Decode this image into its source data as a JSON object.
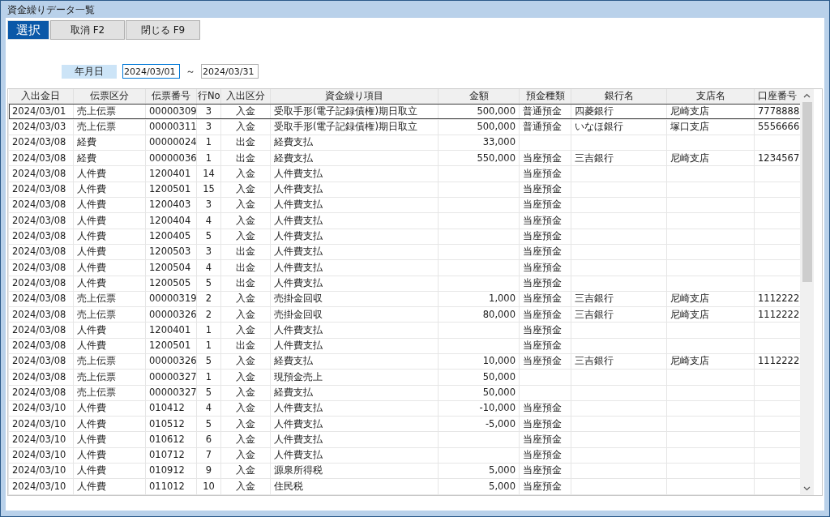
{
  "window": {
    "title": "資金繰りデータ一覧"
  },
  "toolbar": [
    {
      "label": "選択",
      "kind": "primary"
    },
    {
      "label": "取消 F2",
      "kind": "normal"
    },
    {
      "label": "閉じる F9",
      "kind": "normal"
    }
  ],
  "date_range": {
    "label": "年月日",
    "from": "2024/03/01",
    "separator": "～",
    "to": "2024/03/31"
  },
  "table": {
    "columns": [
      "入出金日",
      "伝票区分",
      "伝票番号",
      "行No",
      "入出区分",
      "資金繰り項目",
      "金額",
      "預金種類",
      "銀行名",
      "支店名",
      "口座番号"
    ],
    "rows": [
      {
        "selected": true,
        "cells": [
          "2024/03/01",
          "売上伝票",
          "00000309",
          "3",
          "入金",
          "受取手形(電子記録債権)期日取立",
          "500,000",
          "普通預金",
          "四菱銀行",
          "尼崎支店",
          "7778888"
        ]
      },
      {
        "selected": false,
        "cells": [
          "2024/03/03",
          "売上伝票",
          "00000311",
          "3",
          "入金",
          "受取手形(電子記録債権)期日取立",
          "500,000",
          "普通預金",
          "いなほ銀行",
          "塚口支店",
          "5556666"
        ]
      },
      {
        "selected": false,
        "cells": [
          "2024/03/08",
          "経費",
          "00000024",
          "1",
          "出金",
          "経費支払",
          "33,000",
          "",
          "",
          "",
          ""
        ]
      },
      {
        "selected": false,
        "cells": [
          "2024/03/08",
          "経費",
          "00000036",
          "1",
          "出金",
          "経費支払",
          "550,000",
          "当座預金",
          "三吉銀行",
          "尼崎支店",
          "1234567"
        ]
      },
      {
        "selected": false,
        "cells": [
          "2024/03/08",
          "人件費",
          "1200401",
          "14",
          "入金",
          "人件費支払",
          "",
          "当座預金",
          "",
          "",
          ""
        ]
      },
      {
        "selected": false,
        "cells": [
          "2024/03/08",
          "人件費",
          "1200501",
          "15",
          "入金",
          "人件費支払",
          "",
          "当座預金",
          "",
          "",
          ""
        ]
      },
      {
        "selected": false,
        "cells": [
          "2024/03/08",
          "人件費",
          "1200403",
          "3",
          "入金",
          "人件費支払",
          "",
          "当座預金",
          "",
          "",
          ""
        ]
      },
      {
        "selected": false,
        "cells": [
          "2024/03/08",
          "人件費",
          "1200404",
          "4",
          "入金",
          "人件費支払",
          "",
          "当座預金",
          "",
          "",
          ""
        ]
      },
      {
        "selected": false,
        "cells": [
          "2024/03/08",
          "人件費",
          "1200405",
          "5",
          "入金",
          "人件費支払",
          "",
          "当座預金",
          "",
          "",
          ""
        ]
      },
      {
        "selected": false,
        "cells": [
          "2024/03/08",
          "人件費",
          "1200503",
          "3",
          "出金",
          "人件費支払",
          "",
          "当座預金",
          "",
          "",
          ""
        ]
      },
      {
        "selected": false,
        "cells": [
          "2024/03/08",
          "人件費",
          "1200504",
          "4",
          "出金",
          "人件費支払",
          "",
          "当座預金",
          "",
          "",
          ""
        ]
      },
      {
        "selected": false,
        "cells": [
          "2024/03/08",
          "人件費",
          "1200505",
          "5",
          "出金",
          "人件費支払",
          "",
          "当座預金",
          "",
          "",
          ""
        ]
      },
      {
        "selected": false,
        "cells": [
          "2024/03/08",
          "売上伝票",
          "00000319",
          "2",
          "入金",
          "売掛金回収",
          "1,000",
          "当座預金",
          "三吉銀行",
          "尼崎支店",
          "1112222"
        ]
      },
      {
        "selected": false,
        "cells": [
          "2024/03/08",
          "売上伝票",
          "00000326",
          "2",
          "入金",
          "売掛金回収",
          "80,000",
          "当座預金",
          "三吉銀行",
          "尼崎支店",
          "1112222"
        ]
      },
      {
        "selected": false,
        "cells": [
          "2024/03/08",
          "人件費",
          "1200401",
          "1",
          "入金",
          "人件費支払",
          "",
          "当座預金",
          "",
          "",
          ""
        ]
      },
      {
        "selected": false,
        "cells": [
          "2024/03/08",
          "人件費",
          "1200501",
          "1",
          "出金",
          "人件費支払",
          "",
          "当座預金",
          "",
          "",
          ""
        ]
      },
      {
        "selected": false,
        "cells": [
          "2024/03/08",
          "売上伝票",
          "00000326",
          "5",
          "入金",
          "経費支払",
          "10,000",
          "当座預金",
          "三吉銀行",
          "尼崎支店",
          "1112222"
        ]
      },
      {
        "selected": false,
        "cells": [
          "2024/03/08",
          "売上伝票",
          "00000327",
          "1",
          "入金",
          "現預金売上",
          "50,000",
          "",
          "",
          "",
          ""
        ]
      },
      {
        "selected": false,
        "cells": [
          "2024/03/08",
          "売上伝票",
          "00000327",
          "5",
          "入金",
          "経費支払",
          "50,000",
          "",
          "",
          "",
          ""
        ]
      },
      {
        "selected": false,
        "cells": [
          "2024/03/10",
          "人件費",
          "010412",
          "4",
          "入金",
          "人件費支払",
          "-10,000",
          "当座預金",
          "",
          "",
          ""
        ]
      },
      {
        "selected": false,
        "cells": [
          "2024/03/10",
          "人件費",
          "010512",
          "5",
          "入金",
          "人件費支払",
          "-5,000",
          "当座預金",
          "",
          "",
          ""
        ]
      },
      {
        "selected": false,
        "cells": [
          "2024/03/10",
          "人件費",
          "010612",
          "6",
          "入金",
          "人件費支払",
          "",
          "当座預金",
          "",
          "",
          ""
        ]
      },
      {
        "selected": false,
        "cells": [
          "2024/03/10",
          "人件費",
          "010712",
          "7",
          "入金",
          "人件費支払",
          "",
          "当座預金",
          "",
          "",
          ""
        ]
      },
      {
        "selected": false,
        "cells": [
          "2024/03/10",
          "人件費",
          "010912",
          "9",
          "入金",
          "源泉所得税",
          "5,000",
          "当座預金",
          "",
          "",
          ""
        ]
      },
      {
        "selected": false,
        "cells": [
          "2024/03/10",
          "人件費",
          "011012",
          "10",
          "入金",
          "住民税",
          "5,000",
          "当座預金",
          "",
          "",
          ""
        ]
      }
    ]
  }
}
